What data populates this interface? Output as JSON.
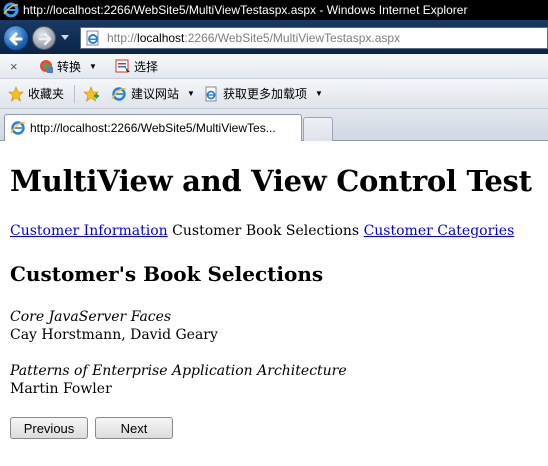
{
  "window": {
    "title": "http://localhost:2266/WebSite5/MultiViewTestaspx.aspx - Windows Internet Explorer"
  },
  "address_bar": {
    "url_prefix": "http://",
    "url_host": "localhost",
    "url_rest": ":2266/WebSite5/MultiViewTestaspx.aspx"
  },
  "command_bar": {
    "convert_label": "转换",
    "select_label": "选择"
  },
  "favorites_bar": {
    "favorites_label": "收藏夹",
    "suggested_sites_label": "建议网站",
    "get_addons_label": "获取更多加载项"
  },
  "tab": {
    "label": "http://localhost:2266/WebSite5/MultiViewTes..."
  },
  "page": {
    "heading": "MultiView and View Control Test",
    "nav_links": [
      "Customer Information",
      "Customer Book Selections",
      "Customer Categories"
    ],
    "section_heading": "Customer's Book Selections",
    "books": [
      {
        "title": "Core JavaServer Faces",
        "author": "Cay Horstmann, David Geary"
      },
      {
        "title": "Patterns of Enterprise Application Architecture",
        "author": "Martin Fowler"
      }
    ],
    "previous_button": "Previous",
    "next_button": "Next"
  },
  "colors": {
    "link": "#0000ee",
    "titlebar": "#000000",
    "addressbar": "#0a2446"
  }
}
